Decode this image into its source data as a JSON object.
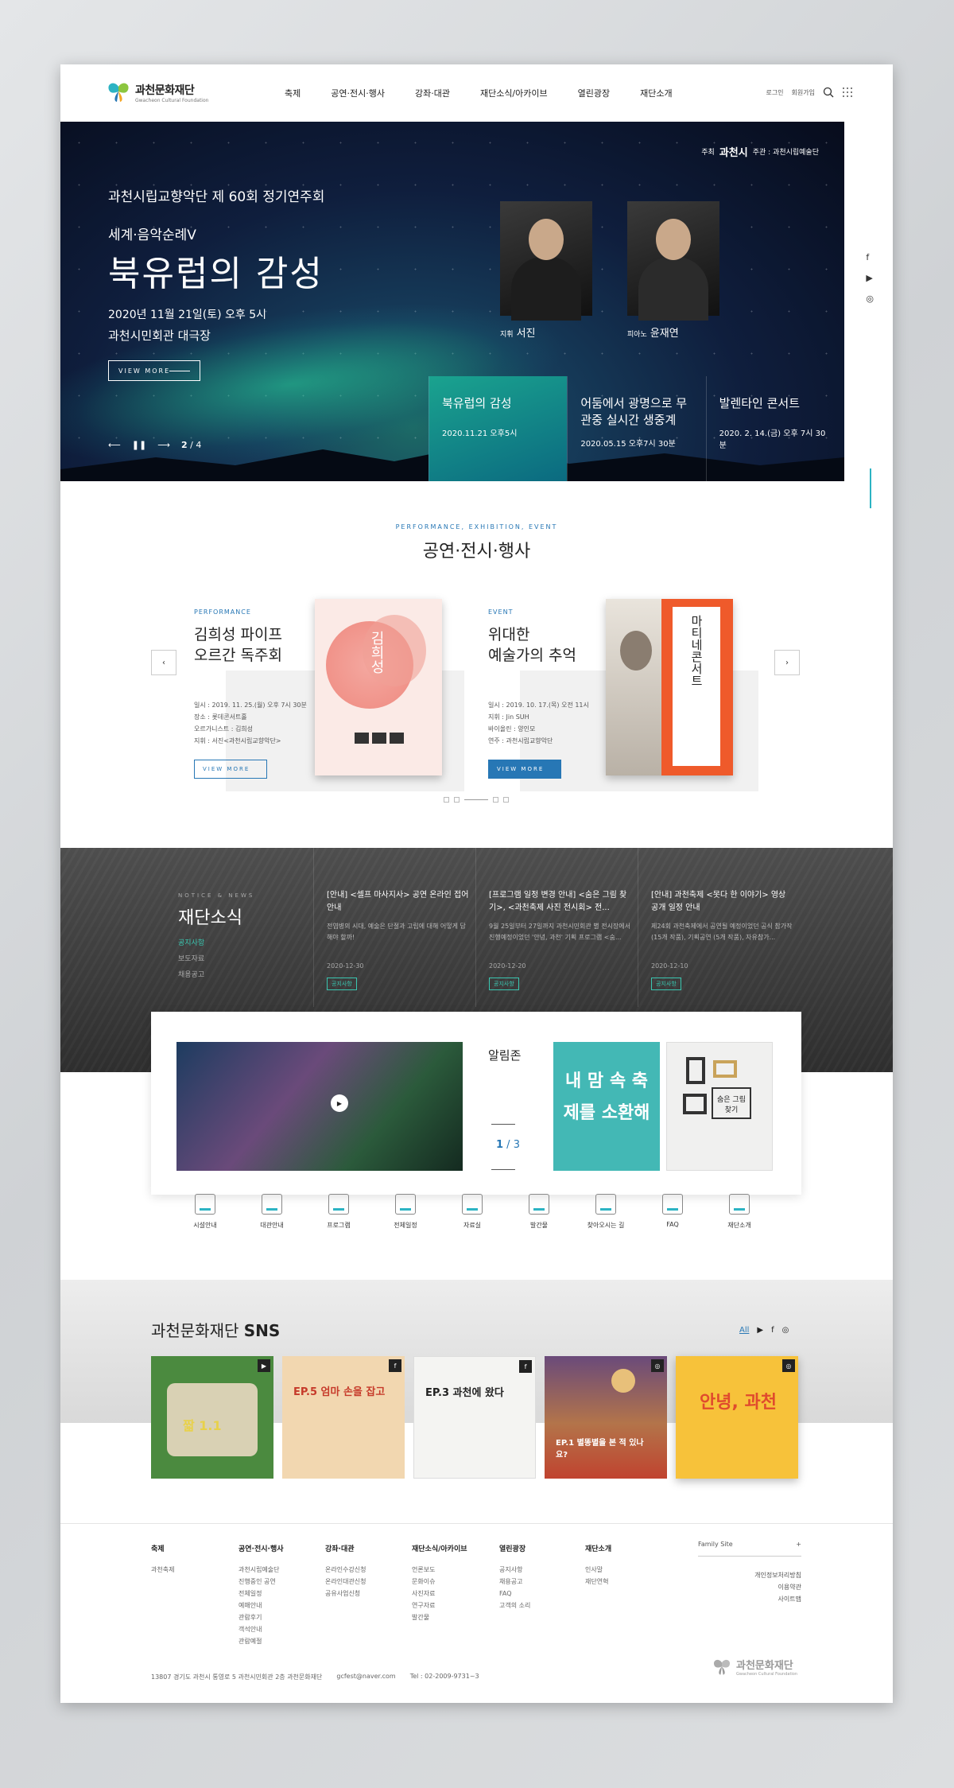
{
  "header": {
    "logo_ko": "과천문화재단",
    "logo_en": "Gwacheon Cultural Foundation",
    "nav": [
      "축제",
      "공연·전시·행사",
      "강좌·대관",
      "재단소식/아카이브",
      "열린광장",
      "재단소개"
    ],
    "login": "로그인",
    "join": "회원가입"
  },
  "hero": {
    "sponsor_label": "주최",
    "sponsor_name": "과천시",
    "host": "주관 : 과천시립예술단",
    "subtitle": "과천시립교향악단 제 60회 정기연주회",
    "series": "세계·음악순례V",
    "title": "북유럽의 감성",
    "date": "2020년 11월 21일(토) 오후 5시",
    "venue": "과천시민회관 대극장",
    "btn": "VIEW MORE",
    "page": "2",
    "total": "/ 4",
    "p1_role": "지휘",
    "p1_name": "서진",
    "p2_role": "피아노",
    "p2_name": "윤재연",
    "tabs": [
      {
        "title": "북유럽의 감성",
        "date": "2020.11.21 오후5시"
      },
      {
        "title": "어둠에서 광명으로 무관중 실시간 생중계",
        "date": "2020.05.15 오후7시 30분"
      },
      {
        "title": "발렌타인 콘서트",
        "date": "2020. 2. 14.(금) 오후 7시 30분"
      }
    ]
  },
  "social": [
    "f",
    "▶",
    "◎"
  ],
  "perf": {
    "en": "PERFORMANCE, EXHIBITION, EVENT",
    "ko": "공연·전시·행사",
    "c1": {
      "label": "PERFORMANCE",
      "title1": "김희성 파이프",
      "title2": "오르간 독주회",
      "info": [
        "일시 : 2019. 11. 25.(월) 오후 7시 30분",
        "장소 : 롯데콘서트홀",
        "오르가니스트 : 김희성",
        "지휘 : 서진<과천시립교향악단>"
      ],
      "btn": "VIEW MORE",
      "poster": "김희성"
    },
    "c2": {
      "label": "EVENT",
      "title1": "위대한",
      "title2": "예술가의 추억",
      "info": [
        "일시 : 2019. 10. 17.(목) 오전 11시",
        "지휘 : Jin SUH",
        "바이올린 : 양인모",
        "연주 : 과천시립교향악단"
      ],
      "btn": "VIEW MORE",
      "poster": "마티네콘서트"
    }
  },
  "news": {
    "en": "NOTICE & NEWS",
    "ko": "재단소식",
    "cats": [
      "공지사항",
      "보도자료",
      "채용공고"
    ],
    "items": [
      {
        "title": "[안내] <셀프 마사지사> 공연 온라인 접어 안내",
        "desc": "전염병의 시대, 예술은 단절과 고립에 대해 어떻게 답해야 할까!",
        "date": "2020-12-30",
        "tag": "공지사항"
      },
      {
        "title": "[프로그램 일정 변경 안내] <숨은 그림 찾기>, <과천축제 사진 전시회> 전...",
        "desc": "9월 25일부터 27일까지 과천시민회관 별 전시장에서 진행예정이었던 '안녕, 과천' 기획 프로그램 <숨...",
        "date": "2020-12-20",
        "tag": "공지사항"
      },
      {
        "title": "[안내] 과천축제 <못다 한 이야기> 영상 공개 일정 안내",
        "desc": "제24회 과천축제에서 공연될 예정이었던 공식 참가작 (15개 작품), 기획공연 (5개 작품), 자유참가...",
        "date": "2020-12-10",
        "tag": "공지사항"
      }
    ]
  },
  "alim": {
    "title": "알림존",
    "page": "1",
    "total": "3",
    "p1": "내 맘 속 축제를 소환해",
    "p2": "숨은 그림 찾기"
  },
  "quick": [
    "시설안내",
    "대관안내",
    "프로그램",
    "전체일정",
    "자료실",
    "발간물",
    "찾아오시는 길",
    "FAQ",
    "재단소개"
  ],
  "sns": {
    "title_a": "과천문화재단",
    "title_b": "SNS",
    "filter": "All",
    "cards": [
      {
        "cap": "짧 1.1",
        "badge": "▶"
      },
      {
        "cap": "EP.5 엄마 손을 잡고",
        "badge": "f"
      },
      {
        "cap": "EP.3 과천에 왔다",
        "badge": "f"
      },
      {
        "cap": "EP.1 별똥별을 본 적 있나요?",
        "badge": "◎"
      },
      {
        "cap": "안녕, 과천",
        "badge": "◎"
      }
    ]
  },
  "footer": {
    "cols": [
      {
        "h": "축제",
        "items": [
          "과천축제"
        ]
      },
      {
        "h": "공연·전시·행사",
        "items": [
          "과천시립예술단",
          "진행중인 공연",
          "전체일정",
          "예매안내",
          "관람후기",
          "객석안내",
          "관람예절"
        ]
      },
      {
        "h": "강좌·대관",
        "items": [
          "온라인수강신청",
          "온라인대관신청",
          "공유사업신청"
        ]
      },
      {
        "h": "재단소식/아카이브",
        "items": [
          "언론보도",
          "문화이슈",
          "사진자료",
          "연구자료",
          "발간물"
        ]
      },
      {
        "h": "열린광장",
        "items": [
          "공지사항",
          "채용공고",
          "FAQ",
          "고객의 소리"
        ]
      },
      {
        "h": "재단소개",
        "items": [
          "인사말",
          "재단연혁"
        ]
      }
    ],
    "family": "Family Site",
    "links": [
      "개인정보처리방침",
      "이용약관",
      "사이트맵"
    ],
    "addr": "13807 경기도 과천시 통영로 5 과천시민회관 2층 과천문화재단",
    "email": "gcfest@naver.com",
    "tel": "Tel : 02-2009-9731~3",
    "logo_ko": "과천문화재단",
    "logo_en": "Gwacheon Cultural Foundation"
  },
  "colors": {
    "accent": "#2777b5",
    "teal": "#1aa38f"
  }
}
